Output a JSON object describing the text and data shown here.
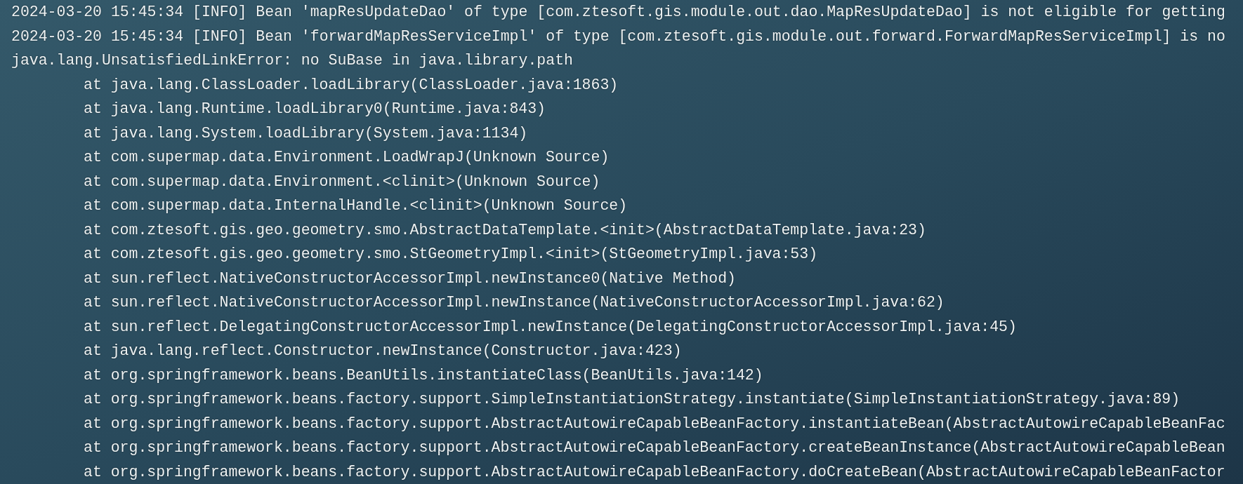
{
  "console": {
    "lines": [
      {
        "kind": "plain",
        "text": "2024-03-20 15:45:34 [INFO] Bean 'mapResUpdateDao' of type [com.ztesoft.gis.module.out.dao.MapResUpdateDao] is not eligible for getting"
      },
      {
        "kind": "plain",
        "text": "2024-03-20 15:45:34 [INFO] Bean 'forwardMapResServiceImpl' of type [com.ztesoft.gis.module.out.forward.ForwardMapResServiceImpl] is no"
      },
      {
        "kind": "plain",
        "text": "java.lang.UnsatisfiedLinkError: no SuBase in java.library.path"
      },
      {
        "kind": "frame",
        "text": "at java.lang.ClassLoader.loadLibrary(ClassLoader.java:1863)"
      },
      {
        "kind": "frame",
        "text": "at java.lang.Runtime.loadLibrary0(Runtime.java:843)"
      },
      {
        "kind": "frame",
        "text": "at java.lang.System.loadLibrary(System.java:1134)"
      },
      {
        "kind": "frame",
        "text": "at com.supermap.data.Environment.LoadWrapJ(Unknown Source)"
      },
      {
        "kind": "frame",
        "text": "at com.supermap.data.Environment.<clinit>(Unknown Source)"
      },
      {
        "kind": "frame",
        "text": "at com.supermap.data.InternalHandle.<clinit>(Unknown Source)"
      },
      {
        "kind": "frame",
        "text": "at com.ztesoft.gis.geo.geometry.smo.AbstractDataTemplate.<init>(AbstractDataTemplate.java:23)"
      },
      {
        "kind": "frame",
        "text": "at com.ztesoft.gis.geo.geometry.smo.StGeometryImpl.<init>(StGeometryImpl.java:53)"
      },
      {
        "kind": "frame",
        "text": "at sun.reflect.NativeConstructorAccessorImpl.newInstance0(Native Method)"
      },
      {
        "kind": "frame",
        "text": "at sun.reflect.NativeConstructorAccessorImpl.newInstance(NativeConstructorAccessorImpl.java:62)"
      },
      {
        "kind": "frame",
        "text": "at sun.reflect.DelegatingConstructorAccessorImpl.newInstance(DelegatingConstructorAccessorImpl.java:45)"
      },
      {
        "kind": "frame",
        "text": "at java.lang.reflect.Constructor.newInstance(Constructor.java:423)"
      },
      {
        "kind": "frame",
        "text": "at org.springframework.beans.BeanUtils.instantiateClass(BeanUtils.java:142)"
      },
      {
        "kind": "frame",
        "text": "at org.springframework.beans.factory.support.SimpleInstantiationStrategy.instantiate(SimpleInstantiationStrategy.java:89)"
      },
      {
        "kind": "frame",
        "text": "at org.springframework.beans.factory.support.AbstractAutowireCapableBeanFactory.instantiateBean(AbstractAutowireCapableBeanFac"
      },
      {
        "kind": "frame",
        "text": "at org.springframework.beans.factory.support.AbstractAutowireCapableBeanFactory.createBeanInstance(AbstractAutowireCapableBean"
      },
      {
        "kind": "frame",
        "text": "at org.springframework.beans.factory.support.AbstractAutowireCapableBeanFactory.doCreateBean(AbstractAutowireCapableBeanFactor"
      }
    ]
  }
}
